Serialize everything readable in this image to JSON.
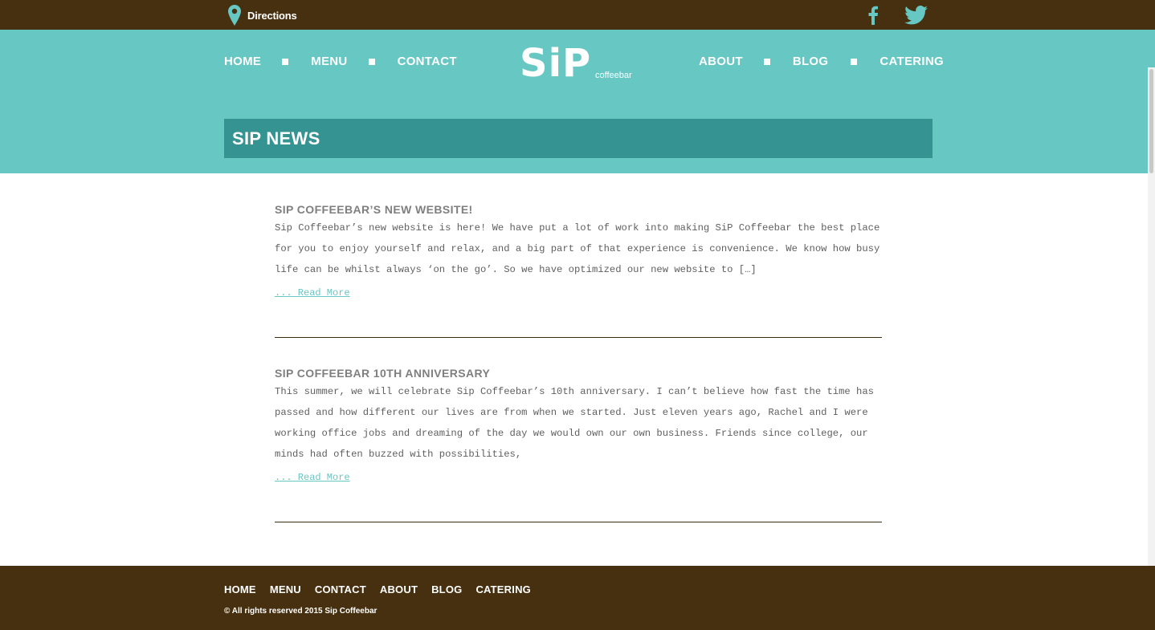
{
  "topbar": {
    "directions_label": "Directions",
    "icons": {
      "location": "map-pin-icon",
      "facebook": "facebook-icon",
      "twitter": "twitter-icon"
    }
  },
  "logo": {
    "brand": "SiP",
    "sub": "coffeebar"
  },
  "nav": {
    "left": [
      "HOME",
      "MENU",
      "CONTACT"
    ],
    "right": [
      "ABOUT",
      "BLOG",
      "CATERING"
    ]
  },
  "page": {
    "title": "SIP NEWS"
  },
  "posts": [
    {
      "title": "SIP COFFEEBAR’S NEW WEBSITE!",
      "excerpt": "Sip Coffeebar’s new website is here! We have put a lot of work into making SiP Coffeebar the best place for you to enjoy yourself and relax, and a big part of that experience is convenience. We know how busy life can be whilst always ‘on the go’. So we have optimized our new website to […]",
      "more": "... Read More"
    },
    {
      "title": "SIP COFFEEBAR 10TH ANNIVERSARY",
      "excerpt": "This summer, we will celebrate Sip Coffeebar’s 10th anniversary. I can’t believe how fast the time has passed and how different our lives are from when we started. Just eleven years ago, Rachel and I were working office jobs and dreaming of the day we would own our own business. Friends since college, our minds had often buzzed with possibilities,",
      "more": "... Read More"
    }
  ],
  "footer": {
    "nav": [
      "HOME",
      "MENU",
      "CONTACT",
      "ABOUT",
      "BLOG",
      "CATERING"
    ],
    "copyright": "© All rights reserved 2015 Sip Coffeebar"
  },
  "colors": {
    "brown": "#46300f",
    "teal": "#67c7c3",
    "dark_teal": "#359391",
    "text_gray": "#5f5f5f"
  }
}
